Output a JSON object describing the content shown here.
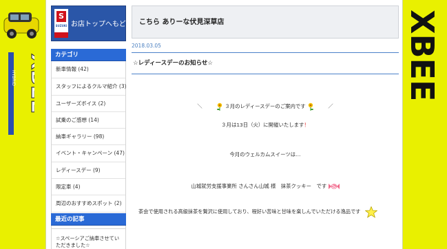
{
  "header": {
    "shop_name": "こちら ありーな伏見深草店",
    "back_to_top": "お店トップへもどる",
    "suzuki_badge": "SUZUKI"
  },
  "sidebar": {
    "categories_title": "カテゴリ",
    "categories": [
      "新車情報 (42)",
      "スタッフによるクルマ紹介 (3)",
      "ユーザーズボイス (2)",
      "試乗のご感想 (14)",
      "納車ギャラリー (98)",
      "イベント・キャンペーン (47)",
      "レディースデー (9)",
      "限定車 (4)",
      "周辺のおすすめスポット (2)",
      "その他 (45)"
    ],
    "recent_title": "最近の記事",
    "recent_items": [
      "☆スペーシアご納車させていただきました☆"
    ]
  },
  "post": {
    "date": "2018.03.05",
    "title": "☆レディースデーのお知らせ☆",
    "line1_left": "＼",
    "line1_text": "３月のレディースデーのご案内です",
    "line1_right": "／",
    "line2_text": "３月は13日（火）に開催いたします",
    "line2_excl": "！",
    "line3_text": "今月のウェルカムスイーツは…",
    "line4_text": "山城就労支援事業所 さんさん山城 様　抹茶クッキー　です",
    "line5_text": "茶会で使用される高級抹茶を贅沢に使用しており、程好い苦味と甘味を楽しんでいただける逸品です"
  },
  "banners": {
    "right_logo": "XBEE",
    "left_logo": "XBEE",
    "left_badge": "HYBRID"
  },
  "icons": [
    "flower-icon",
    "candy-icon",
    "star-icon",
    "suzuki-logo-icon"
  ],
  "colors": {
    "background": "#e9f000",
    "accent_blue": "#2a6ad6",
    "divider_blue": "#4a80c8",
    "date_blue": "#4a7fc0",
    "exclaim_red": "#e02020",
    "suzuki_red": "#d0121b"
  }
}
